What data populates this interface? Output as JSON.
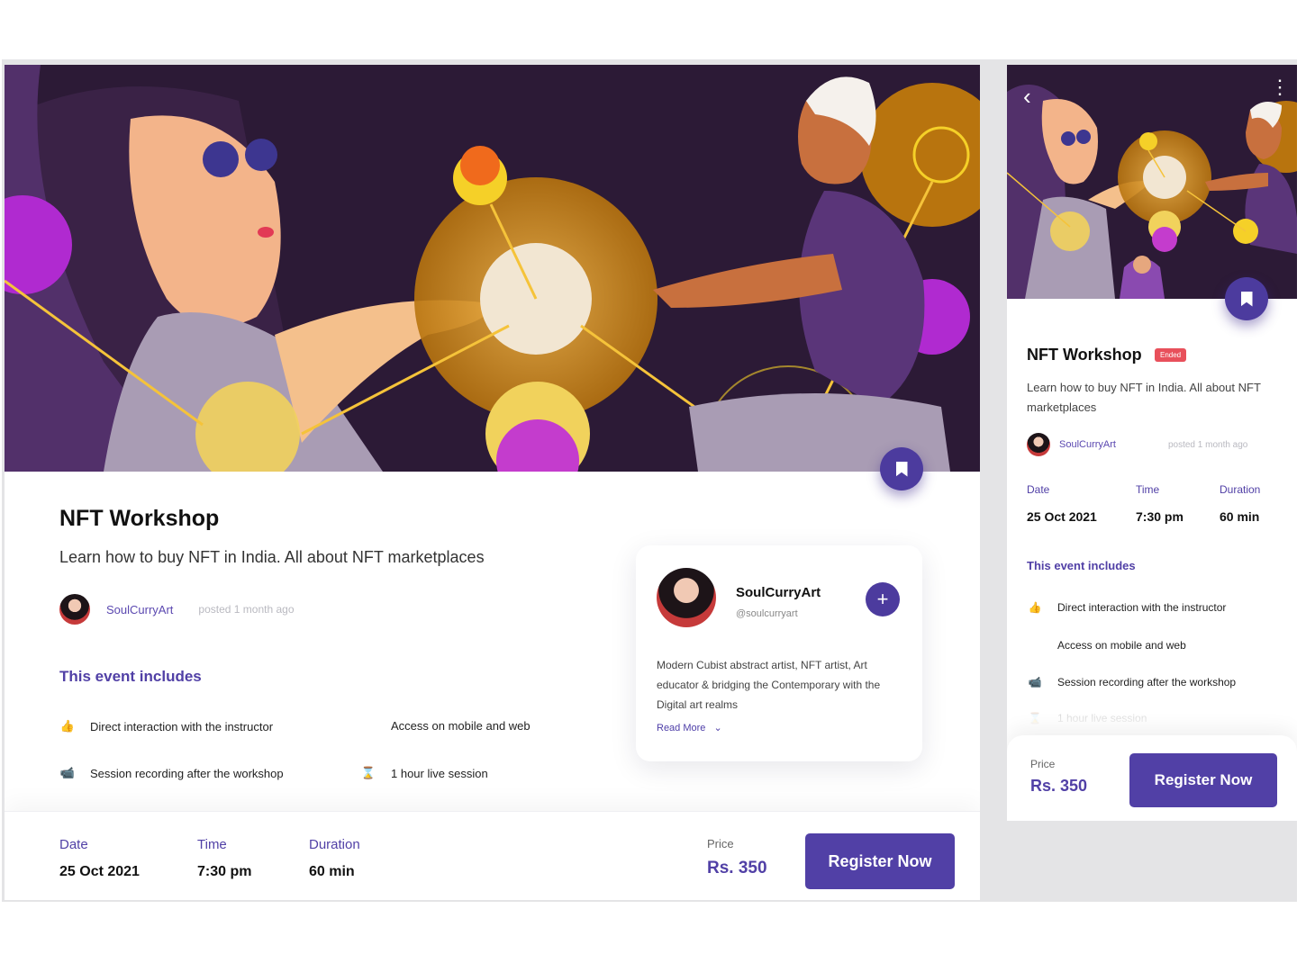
{
  "event": {
    "title": "NFT Workshop",
    "subtitle": "Learn how to buy NFT in India. All about NFT marketplaces",
    "status_badge": "Ended",
    "author": "SoulCurryArt",
    "posted": "posted 1 month ago",
    "includes_title": "This event includes",
    "features": [
      {
        "icon": "thumbs-up-icon",
        "label": "Direct interaction with the instructor"
      },
      {
        "icon": "mobile-icon",
        "label": "Access on mobile and web"
      },
      {
        "icon": "video-camera-icon",
        "label": "Session recording after the workshop"
      },
      {
        "icon": "hourglass-icon",
        "label": "1 hour live session"
      }
    ],
    "date_label": "Date",
    "date_value": "25 Oct 2021",
    "time_label": "Time",
    "time_value": "7:30 pm",
    "duration_label": "Duration",
    "duration_value": "60 min",
    "price_label": "Price",
    "price_value": "Rs. 350",
    "register_label": "Register Now"
  },
  "creator": {
    "name": "SoulCurryArt",
    "handle": "@soulcurryart",
    "bio": "Modern Cubist abstract artist, NFT artist, Art educator & bridging the Contemporary with the Digital art realms",
    "read_more": "Read More",
    "follow_symbol": "+"
  },
  "icons": {
    "thumbs": "👍",
    "camera": "📹",
    "hourglass": "⌛",
    "chevron": "⌄",
    "back": "‹",
    "menu": "⋮"
  },
  "colors": {
    "accent": "#5140a6",
    "badge": "#e8505b",
    "hero_bg": "#2c1a36"
  }
}
